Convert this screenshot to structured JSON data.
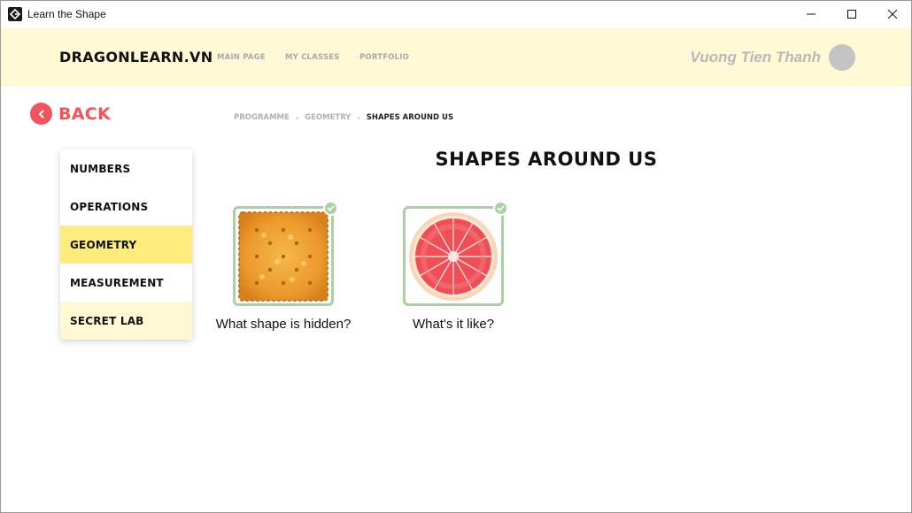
{
  "window": {
    "title": "Learn the Shape"
  },
  "topnav": {
    "brand": "DRAGONLEARN.VN",
    "links": [
      "MAIN PAGE",
      "MY CLASSES",
      "PORTFOLIO"
    ],
    "user_name": "Vuong Tien Thanh"
  },
  "back": {
    "label": "BACK"
  },
  "breadcrumb": [
    "PROGRAMME",
    "GEOMETRY",
    "SHAPES AROUND US"
  ],
  "sidebar": {
    "items": [
      "NUMBERS",
      "OPERATIONS",
      "GEOMETRY",
      "MEASUREMENT",
      "SECRET LAB"
    ],
    "selected": "GEOMETRY"
  },
  "page": {
    "title": "SHAPES AROUND US"
  },
  "cards": [
    {
      "caption": "What shape is hidden?",
      "image": "cracker",
      "completed": true
    },
    {
      "caption": "What's it like?",
      "image": "grapefruit-slice",
      "completed": true
    }
  ],
  "colors": {
    "nav_bg": "#fff9d6",
    "accent_red": "#f2545f",
    "active_item": "#fdeb7b",
    "secret_item": "#fff8d3",
    "card_border": "#a9d1a3"
  }
}
